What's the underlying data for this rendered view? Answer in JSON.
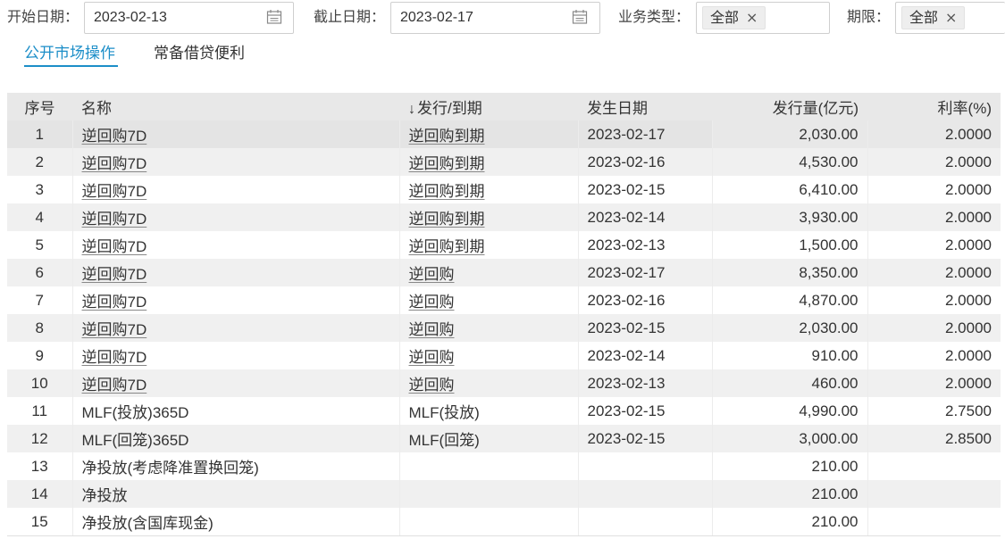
{
  "filters": {
    "start_date_label": "开始日期：",
    "start_date_value": "2023-02-13",
    "end_date_label": "截止日期：",
    "end_date_value": "2023-02-17",
    "biz_type_label": "业务类型：",
    "biz_type_tag": "全部",
    "term_label": "期限：",
    "term_tag": "全部",
    "remove_glyph": "×"
  },
  "tabs": [
    {
      "label": "公开市场操作",
      "active": true
    },
    {
      "label": "常备借贷便利",
      "active": false
    }
  ],
  "table": {
    "sort_glyph": "↓",
    "columns": [
      "序号",
      "名称",
      "发行/到期",
      "发生日期",
      "发行量(亿元)",
      "利率(%)"
    ],
    "rows": [
      {
        "no": "1",
        "name": "逆回购7D",
        "type": "逆回购到期",
        "date": "2023-02-17",
        "amount": "2,030.00",
        "rate": "2.0000"
      },
      {
        "no": "2",
        "name": "逆回购7D",
        "type": "逆回购到期",
        "date": "2023-02-16",
        "amount": "4,530.00",
        "rate": "2.0000"
      },
      {
        "no": "3",
        "name": "逆回购7D",
        "type": "逆回购到期",
        "date": "2023-02-15",
        "amount": "6,410.00",
        "rate": "2.0000"
      },
      {
        "no": "4",
        "name": "逆回购7D",
        "type": "逆回购到期",
        "date": "2023-02-14",
        "amount": "3,930.00",
        "rate": "2.0000"
      },
      {
        "no": "5",
        "name": "逆回购7D",
        "type": "逆回购到期",
        "date": "2023-02-13",
        "amount": "1,500.00",
        "rate": "2.0000"
      },
      {
        "no": "6",
        "name": "逆回购7D",
        "type": "逆回购",
        "date": "2023-02-17",
        "amount": "8,350.00",
        "rate": "2.0000"
      },
      {
        "no": "7",
        "name": "逆回购7D",
        "type": "逆回购",
        "date": "2023-02-16",
        "amount": "4,870.00",
        "rate": "2.0000"
      },
      {
        "no": "8",
        "name": "逆回购7D",
        "type": "逆回购",
        "date": "2023-02-15",
        "amount": "2,030.00",
        "rate": "2.0000"
      },
      {
        "no": "9",
        "name": "逆回购7D",
        "type": "逆回购",
        "date": "2023-02-14",
        "amount": "910.00",
        "rate": "2.0000"
      },
      {
        "no": "10",
        "name": "逆回购7D",
        "type": "逆回购",
        "date": "2023-02-13",
        "amount": "460.00",
        "rate": "2.0000"
      },
      {
        "no": "11",
        "name": "MLF(投放)365D",
        "type": "MLF(投放)",
        "date": "2023-02-15",
        "amount": "4,990.00",
        "rate": "2.7500"
      },
      {
        "no": "12",
        "name": "MLF(回笼)365D",
        "type": "MLF(回笼)",
        "date": "2023-02-15",
        "amount": "3,000.00",
        "rate": "2.8500"
      },
      {
        "no": "13",
        "name": "净投放(考虑降准置换回笼)",
        "type": "",
        "date": "",
        "amount": "210.00",
        "rate": ""
      },
      {
        "no": "14",
        "name": "净投放",
        "type": "",
        "date": "",
        "amount": "210.00",
        "rate": ""
      },
      {
        "no": "15",
        "name": "净投放(含国库现金)",
        "type": "",
        "date": "",
        "amount": "210.00",
        "rate": ""
      }
    ]
  },
  "colors": {
    "accent": "#1c8ec8",
    "header_bg": "#e8e8e8",
    "row_alt": "#f0f0f0"
  }
}
